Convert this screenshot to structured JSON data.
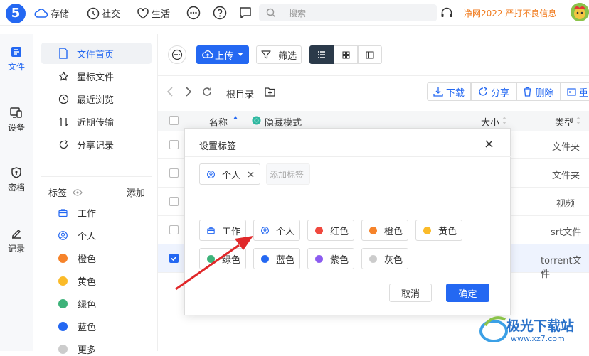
{
  "topbar": {
    "logo_text": "5",
    "nav": [
      "存储",
      "社交",
      "生活"
    ],
    "search_placeholder": "搜索",
    "promo": "净网2022 严打不良信息"
  },
  "leftnav": [
    "文件",
    "设备",
    "密档",
    "记录"
  ],
  "sidebar": {
    "items": [
      "文件首页",
      "星标文件",
      "最近浏览",
      "近期传输",
      "分享记录"
    ],
    "tags_title": "标签",
    "tags_add": "添加",
    "tags": [
      {
        "label": "工作",
        "icon": "briefcase-icon"
      },
      {
        "label": "个人",
        "icon": "person-icon"
      },
      {
        "label": "橙色",
        "color": "#f6832a"
      },
      {
        "label": "黄色",
        "color": "#fbbb29"
      },
      {
        "label": "绿色",
        "color": "#3eb37a"
      },
      {
        "label": "蓝色",
        "color": "#2468f2"
      },
      {
        "label": "更多",
        "color": "#cccccc"
      }
    ]
  },
  "toolbar": {
    "upload": "上传",
    "filter": "筛选",
    "download": "下载",
    "share": "分享",
    "delete": "删除",
    "rename": "重"
  },
  "breadcrumb": {
    "root": "根目录"
  },
  "table": {
    "col_name": "名称",
    "hidden_mode": "隐藏模式",
    "col_size": "大小",
    "col_type": "类型",
    "rows": [
      {
        "type": "文件夹",
        "checked": false
      },
      {
        "type": "文件夹",
        "checked": false
      },
      {
        "type": "视频",
        "checked": false
      },
      {
        "type": "srt文件",
        "checked": false
      },
      {
        "type": "torrent文件",
        "checked": true
      }
    ]
  },
  "dialog": {
    "title": "设置标签",
    "selected": "个人",
    "add_placeholder": "添加标签",
    "options": [
      {
        "label": "工作",
        "icon": "briefcase-icon"
      },
      {
        "label": "个人",
        "icon": "person-icon"
      },
      {
        "label": "红色",
        "color": "#f0483e"
      },
      {
        "label": "橙色",
        "color": "#f6832a"
      },
      {
        "label": "黄色",
        "color": "#fbbb29"
      },
      {
        "label": "绿色",
        "color": "#3eb37a"
      },
      {
        "label": "蓝色",
        "color": "#2468f2"
      },
      {
        "label": "紫色",
        "color": "#8c5cf0"
      },
      {
        "label": "灰色",
        "color": "#cccccc"
      }
    ],
    "cancel": "取消",
    "confirm": "确定"
  },
  "watermark": {
    "text": "极光下载站",
    "url_text": "www.xz7.com"
  },
  "colors": {
    "accent": "#2468f2",
    "promo": "#f07a1c",
    "annotation_arrow": "#e0282a"
  }
}
